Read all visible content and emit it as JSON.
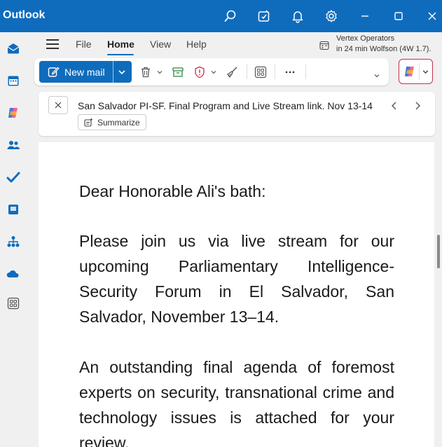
{
  "app": {
    "title": "Outlook"
  },
  "titlebar_icons": [
    "search-icon",
    "compose-note-icon",
    "bell-icon",
    "gear-icon",
    "minimize-icon",
    "maximize-icon",
    "close-icon"
  ],
  "menu": {
    "tabs": [
      {
        "label": "File"
      },
      {
        "label": "Home"
      },
      {
        "label": "View"
      },
      {
        "label": "Help"
      }
    ],
    "active_tab": "Home"
  },
  "meeting": {
    "title": "Vertex Operators",
    "detail": "in 24 min Wolfson (4W 1.7)."
  },
  "ribbon": {
    "new_mail_label": "New mail"
  },
  "message": {
    "subject": "San Salvador PI-SF. Final Program and Live Stream link. Nov 13-14",
    "summarize_label": "Summarize",
    "greeting": "Dear Honorable Ali's bath:",
    "paragraph1": "Please join us via live stream for our upcoming Parliamentary Intelligence-Security Forum in El Salvador, San Salvador, November 13–14.",
    "paragraph2": "An outstanding final agenda of foremost experts on security, transnational crime and technology issues is attached for your review."
  },
  "colors": {
    "brand": "#0f6cbd",
    "copilot_border": "#c4314b"
  }
}
